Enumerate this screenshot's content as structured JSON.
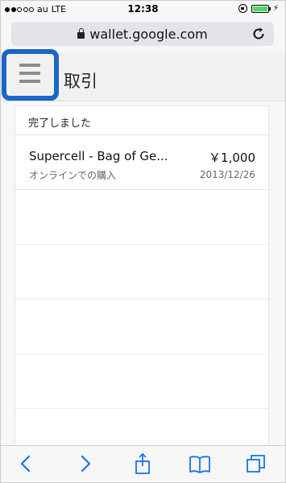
{
  "status_bar": {
    "carrier": "au",
    "network": "LTE",
    "time": "12:38",
    "signal_bars": 2,
    "signal_total": 5,
    "battery_level": 1.0,
    "battery_color": "#4cd964"
  },
  "browser": {
    "url": "wallet.google.com",
    "secure": true
  },
  "header": {
    "title": "取引",
    "menu_icon": "hamburger-menu-icon",
    "highlight_color": "#1a66c9"
  },
  "section": {
    "label": "完了しました"
  },
  "transactions": [
    {
      "name": "Supercell - Bag of Ge...",
      "amount": "￥1,000",
      "type": "オンラインでの購入",
      "date": "2013/12/26"
    }
  ],
  "toolbar": {
    "icons": [
      "back-icon",
      "forward-icon",
      "share-icon",
      "bookmarks-icon",
      "tabs-icon"
    ],
    "accent_color": "#1a73e8"
  }
}
